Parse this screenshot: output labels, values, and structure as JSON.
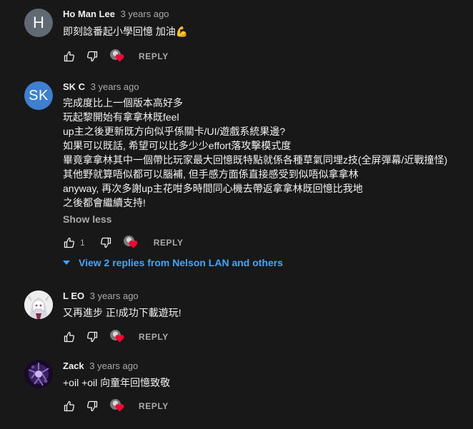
{
  "comments": [
    {
      "author": "Ho Man Lee",
      "time": "3 years ago",
      "avatar_letter": "H",
      "lines": [
        "即刻諗番起小學回憶 加油💪"
      ],
      "likes": "",
      "reply_label": "REPLY"
    },
    {
      "author": "SK C",
      "time": "3 years ago",
      "avatar_letter": "SK",
      "lines": [
        "完成度比上一個版本高好多",
        "玩起黎開始有拿拿林既feel",
        "up主之後更新既方向似乎係關卡/UI/遊戲系統果邊?",
        "如果可以既話, 希望可以比多少少effort落攻擊模式度",
        "畢竟拿拿林其中一個帶比玩家最大回憶既特點就係各種草氣同埋z技(全屏彈幕/近戰撞怪)",
        "其他野就算唔似都可以腦補, 但手感方面係直接感受到似唔似拿拿林",
        "anyway, 再次多謝up主花咁多時間同心機去帶返拿拿林既回憶比我地",
        "之後都會繼續支持!"
      ],
      "show_less_label": "Show less",
      "likes": "1",
      "reply_label": "REPLY",
      "view_replies_label": "View 2 replies from Nelson LAN and others"
    },
    {
      "author": "L EO",
      "time": "3 years ago",
      "lines": [
        "又再進步 正!成功下載遊玩!"
      ],
      "likes": "",
      "reply_label": "REPLY"
    },
    {
      "author": "Zack",
      "time": "3 years ago",
      "lines": [
        "+oil +oil 向童年回憶致敬"
      ],
      "likes": "",
      "reply_label": "REPLY"
    }
  ],
  "colors": {
    "background": "#181818",
    "text": "#f1f1f1",
    "muted": "#aaaaaa",
    "link": "#3ea6ff",
    "heart": "#ff0033"
  },
  "icons": [
    "like-icon",
    "dislike-icon",
    "creator-heart-icon",
    "chevron-down-icon"
  ]
}
